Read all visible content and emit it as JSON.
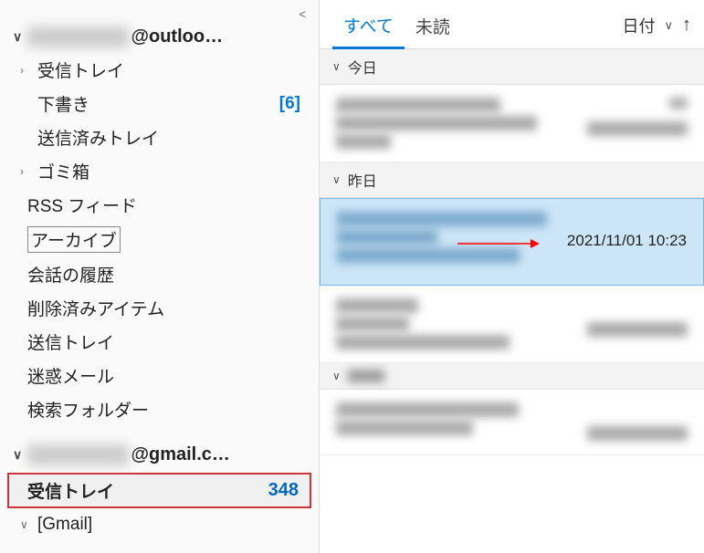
{
  "sidebar": {
    "accounts": [
      {
        "name_masked": "xxxxxxxxxx",
        "domain": "@outloo…",
        "folders": [
          {
            "label": "受信トレイ",
            "has_chev": true
          },
          {
            "label": "下書き",
            "count": "[6]"
          },
          {
            "label": "送信済みトレイ"
          },
          {
            "label": "ゴミ箱",
            "has_chev": true
          },
          {
            "label": "RSS フィード",
            "sub": true
          },
          {
            "label": "アーカイブ",
            "sub": true,
            "boxed": true
          },
          {
            "label": "会話の履歴",
            "sub": true
          },
          {
            "label": "削除済みアイテム",
            "sub": true
          },
          {
            "label": "送信トレイ",
            "sub": true
          },
          {
            "label": "迷惑メール",
            "sub": true
          },
          {
            "label": "検索フォルダー",
            "sub": true
          }
        ]
      },
      {
        "name_masked": "xxxxxxxxxx",
        "domain": "@gmail.c…",
        "folders": [
          {
            "label": "受信トレイ",
            "count": "348",
            "highlight": true
          },
          {
            "label": "[Gmail]",
            "has_chev": true
          }
        ]
      }
    ]
  },
  "main": {
    "tabs": {
      "all": "すべて",
      "unread": "未読"
    },
    "sort": {
      "label": "日付"
    },
    "groups": {
      "today": "今日",
      "yesterday": "昨日",
      "selected_timestamp": "2021/11/01 10:23"
    }
  }
}
